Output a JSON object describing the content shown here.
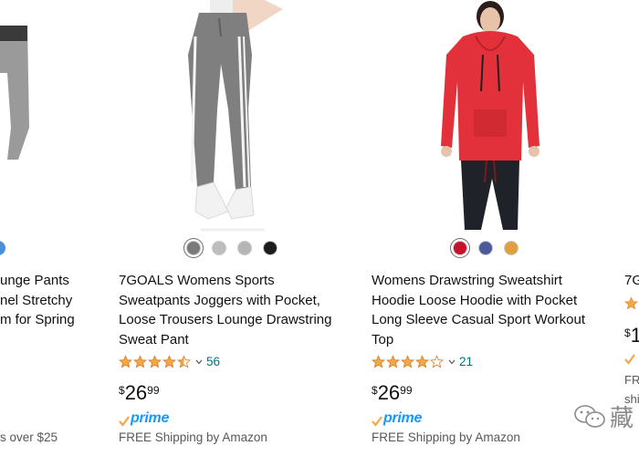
{
  "products": [
    {
      "title_lines": [
        "unge Pants",
        "nel Stretchy",
        "m for Spring"
      ],
      "shipping": "s over $25"
    },
    {
      "title_lines": [
        "7GOALS Womens Sports",
        "Sweatpants Joggers with Pocket,",
        "Loose Trousers Lounge Drawstring",
        "Sweat Pant"
      ],
      "rating": 4.5,
      "review_count": "56",
      "price_symbol": "$",
      "price_whole": "26",
      "price_fraction": "99",
      "prime_label": "prime",
      "shipping": "FREE Shipping by Amazon",
      "swatch_colors": [
        "#7a7a7a",
        "#bdbdbd",
        "#b5b5b5",
        "#1c1c1c"
      ],
      "selected_swatch": 0
    },
    {
      "title_lines": [
        "Womens Drawstring Sweatshirt",
        "Hoodie Loose Hoodie with Pocket",
        "Long Sleeve Casual Sport Workout",
        "Top"
      ],
      "rating": 4.0,
      "review_count": "21",
      "price_symbol": "$",
      "price_whole": "26",
      "price_fraction": "99",
      "prime_label": "prime",
      "shipping": "FREE Shipping by Amazon",
      "swatch_colors": [
        "#c8102e",
        "#4a5a9a",
        "#e0a040"
      ],
      "selected_swatch": 0
    },
    {
      "title_lines": [
        "7G"
      ],
      "price_symbol": "$",
      "price_whole": "1",
      "shipping_lines": [
        "FRE",
        "shi"
      ]
    }
  ],
  "colors": {
    "link": "#007185",
    "prime_blue": "#1399ff",
    "star": "#f3a847",
    "hoodie_red": "#e2313a"
  },
  "watermark": {
    "text": "藏",
    "icon": "wechat-icon"
  }
}
